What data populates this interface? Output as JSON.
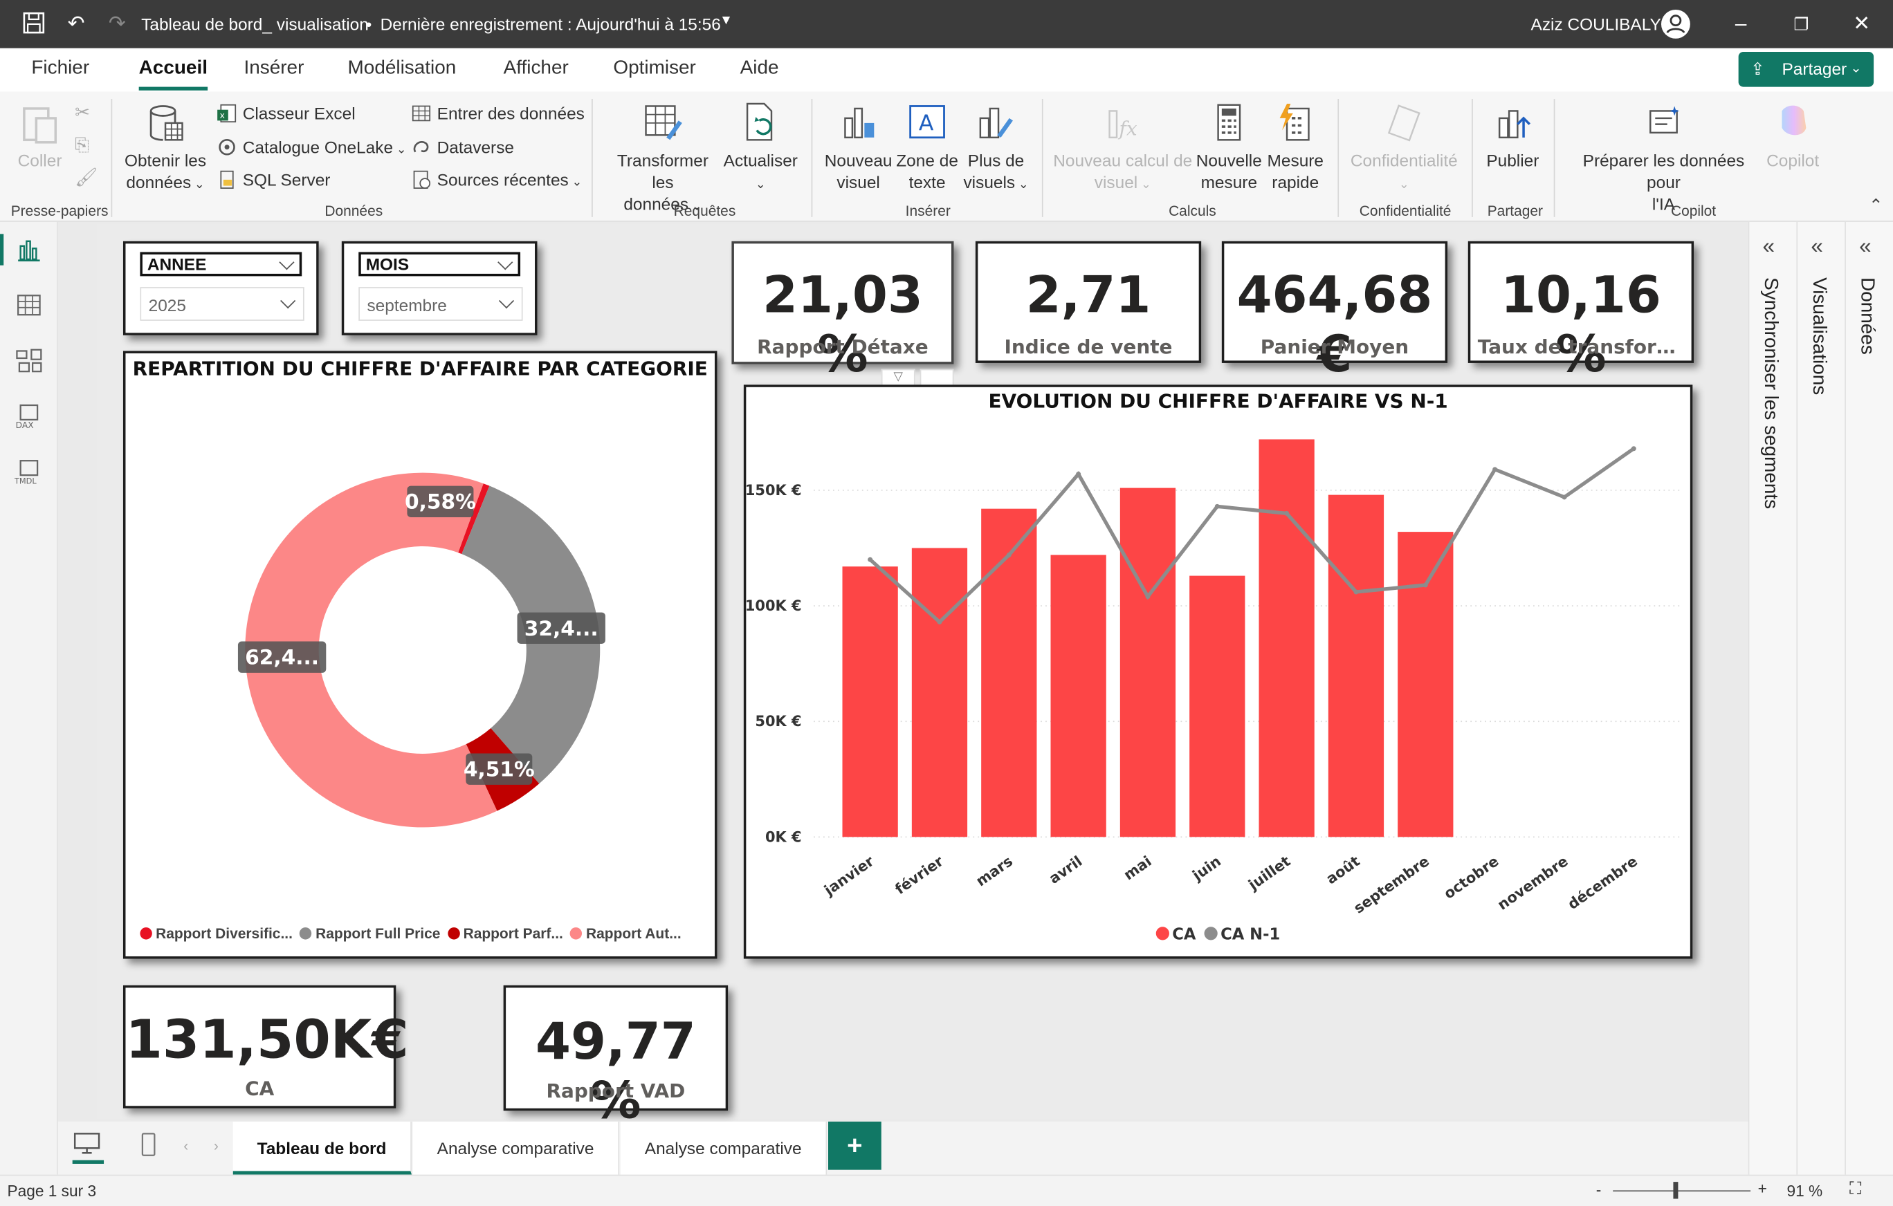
{
  "window": {
    "title": "Tableau de bord_ visualisation",
    "saved": "Dernière enregistrement : Aujourd'hui à 15:56",
    "user": "Aziz COULIBALY"
  },
  "menu": {
    "items": [
      "Fichier",
      "Accueil",
      "Insérer",
      "Modélisation",
      "Afficher",
      "Optimiser",
      "Aide"
    ],
    "share": "Partager"
  },
  "ribbon": {
    "paste": "Coller",
    "clipboard_group": "Presse-papiers",
    "get_data": "Obtenir les",
    "get_data2": "données",
    "excel": "Classeur Excel",
    "onelake": "Catalogue OneLake",
    "sql": "SQL Server",
    "enter_data": "Entrer des données",
    "dataverse": "Dataverse",
    "recent": "Sources récentes",
    "data_group": "Données",
    "transform": "Transformer les",
    "transform2": "données",
    "refresh": "Actualiser",
    "queries_group": "Requêtes",
    "new_visual": "Nouveau",
    "new_visual2": "visuel",
    "textbox": "Zone de",
    "textbox2": "texte",
    "more_visuals": "Plus de",
    "more_visuals2": "visuels",
    "insert_group": "Insérer",
    "new_calc": "Nouveau calcul de",
    "new_calc2": "visuel",
    "new_measure": "Nouvelle",
    "new_measure2": "mesure",
    "quick_measure": "Mesure",
    "quick_measure2": "rapide",
    "calc_group": "Calculs",
    "sensitivity": "Confidentialité",
    "sensitivity_group": "Confidentialité",
    "publish": "Publier",
    "share_group": "Partager",
    "prep_ai": "Préparer les données pour",
    "prep_ai2": "l'IA",
    "copilot": "Copilot",
    "copilot_group": "Copilot"
  },
  "slicers": {
    "year": {
      "title": "ANNEE",
      "value": "2025"
    },
    "month": {
      "title": "MOIS",
      "value": "septembre"
    }
  },
  "kpis": {
    "detaxe": {
      "value": "21,03 %",
      "label": "Rapport Détaxe"
    },
    "sales_index": {
      "value": "2,71",
      "label": "Indice de vente"
    },
    "basket": {
      "value": "464,68 €",
      "label": "Panier Moyen"
    },
    "conversion": {
      "value": "10,16 %",
      "label": "Taux de transforma..."
    },
    "ca": {
      "value": "131,50K€",
      "label": "CA"
    },
    "vad": {
      "value": "49,77 %",
      "label": "Rapport VAD"
    }
  },
  "colors": {
    "accent": "#117865",
    "bar": "#fd4546",
    "line": "#8c8c8c",
    "dark_red": "#c00000",
    "red": "#e81123",
    "pink": "#fc8787",
    "grey": "#8c8c8c"
  },
  "chart_data": [
    {
      "type": "pie",
      "title": "REPARTITION DU CHIFFRE D'AFFAIRE PAR CATEGORIE",
      "slices": [
        {
          "name": "Rapport Diversific...",
          "value": 0.58,
          "label": "0,58%",
          "color": "#e81123"
        },
        {
          "name": "Rapport Full Price",
          "value": 32.4,
          "label": "32,4...",
          "color": "#8c8c8c"
        },
        {
          "name": "Rapport Parf...",
          "value": 4.51,
          "label": "4,51%",
          "color": "#c00000"
        },
        {
          "name": "Rapport Aut...",
          "value": 62.4,
          "label": "62,4...",
          "color": "#fc8787"
        }
      ]
    },
    {
      "type": "bar",
      "title": "EVOLUTION DU CHIFFRE D'AFFAIRE VS N-1",
      "categories": [
        "janvier",
        "février",
        "mars",
        "avril",
        "mai",
        "juin",
        "juillet",
        "août",
        "septembre",
        "octobre",
        "novembre",
        "décembre"
      ],
      "series": [
        {
          "name": "CA",
          "type": "bar",
          "color": "#fd4546",
          "values": [
            117,
            125,
            142,
            122,
            151,
            113,
            172,
            148,
            132,
            null,
            null,
            null
          ]
        },
        {
          "name": "CA N-1",
          "type": "line",
          "color": "#8c8c8c",
          "values": [
            120,
            93,
            122,
            157,
            104,
            143,
            140,
            106,
            109,
            159,
            147,
            168
          ]
        }
      ],
      "yticks": [
        "0K €",
        "50K €",
        "100K €",
        "150K €"
      ],
      "ylim": [
        0,
        180
      ]
    }
  ],
  "right_panes": {
    "sync": "Synchroniser les segments",
    "visuals": "Visualisations",
    "data": "Données"
  },
  "tabs": [
    "Tableau de bord",
    "Analyse comparative",
    "Analyse comparative"
  ],
  "status": {
    "page": "Page 1 sur 3",
    "zoom": "91 %"
  }
}
